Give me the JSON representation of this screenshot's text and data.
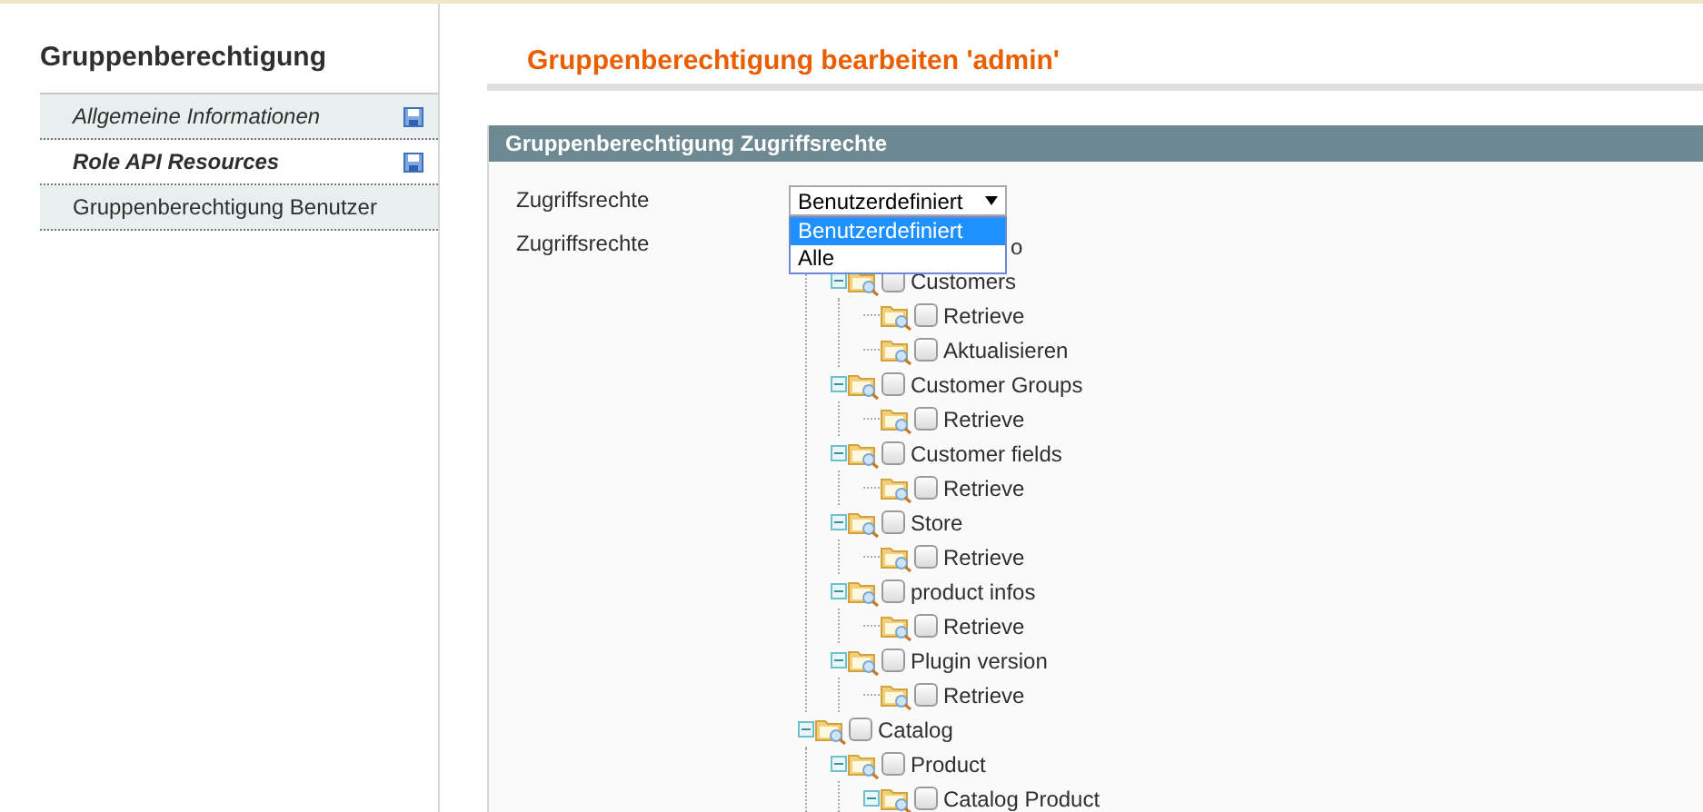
{
  "sidebar": {
    "title": "Gruppenberechtigung",
    "items": [
      {
        "label": "Allgemeine Informationen",
        "selected": false,
        "changed": true
      },
      {
        "label": "Role API Resources",
        "selected": true,
        "changed": true
      },
      {
        "label": "Gruppenberechtigung Benutzer",
        "selected": false,
        "changed": false
      }
    ]
  },
  "main": {
    "title": "Gruppenberechtigung bearbeiten 'admin'",
    "section": {
      "title": "Gruppenberechtigung Zugriffsrechte",
      "fields": [
        {
          "kind": "select",
          "label": "Zugriffsrechte",
          "value": "Benutzerdefiniert",
          "open": true,
          "options": [
            {
              "label": "Benutzerdefiniert",
              "selected": true
            },
            {
              "label": "Alle",
              "selected": false
            }
          ]
        },
        {
          "kind": "tree",
          "label": "Zugriffsrechte",
          "nodes": [
            {
              "kind": "covered",
              "label": "o",
              "children": [
                {
                  "kind": "node",
                  "label": "Customers",
                  "checked": false,
                  "expanded": true,
                  "children": [
                    {
                      "kind": "node",
                      "label": "Retrieve",
                      "checked": false
                    },
                    {
                      "kind": "node",
                      "label": "Aktualisieren",
                      "checked": false
                    }
                  ]
                },
                {
                  "kind": "node",
                  "label": "Customer Groups",
                  "checked": false,
                  "expanded": true,
                  "children": [
                    {
                      "kind": "node",
                      "label": "Retrieve",
                      "checked": false
                    }
                  ]
                },
                {
                  "kind": "node",
                  "label": "Customer fields",
                  "checked": false,
                  "expanded": true,
                  "children": [
                    {
                      "kind": "node",
                      "label": "Retrieve",
                      "checked": false
                    }
                  ]
                },
                {
                  "kind": "node",
                  "label": "Store",
                  "checked": false,
                  "expanded": true,
                  "children": [
                    {
                      "kind": "node",
                      "label": "Retrieve",
                      "checked": false
                    }
                  ]
                },
                {
                  "kind": "node",
                  "label": "product infos",
                  "checked": false,
                  "expanded": true,
                  "children": [
                    {
                      "kind": "node",
                      "label": "Retrieve",
                      "checked": false
                    }
                  ]
                },
                {
                  "kind": "node",
                  "label": "Plugin version",
                  "checked": false,
                  "expanded": true,
                  "children": [
                    {
                      "kind": "node",
                      "label": "Retrieve",
                      "checked": false
                    }
                  ]
                }
              ]
            },
            {
              "kind": "node",
              "label": "Catalog",
              "checked": false,
              "expanded": true,
              "children": [
                {
                  "kind": "node",
                  "label": "Product",
                  "checked": false,
                  "expanded": true,
                  "children": [
                    {
                      "kind": "node",
                      "label": "Catalog Product",
                      "checked": false,
                      "expanded": true
                    }
                  ]
                }
              ]
            }
          ]
        }
      ]
    }
  }
}
